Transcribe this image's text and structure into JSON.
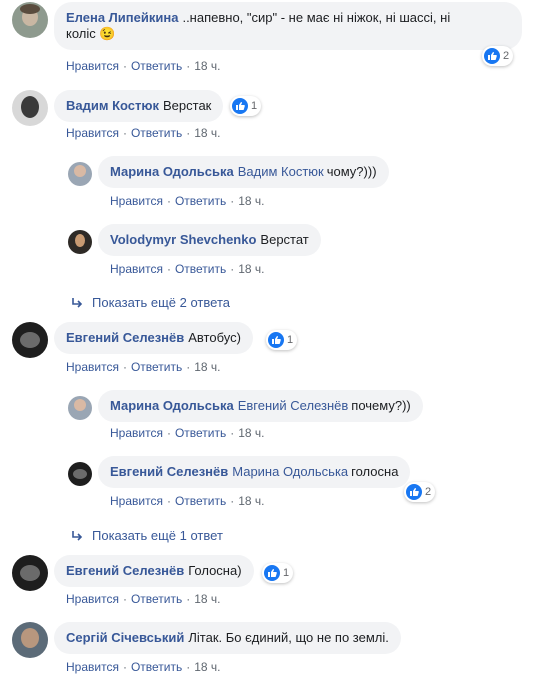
{
  "actions": {
    "like": "Нравится",
    "reply": "Ответить",
    "sep": "·"
  },
  "comments": [
    {
      "author": "Елена Липейкина",
      "text": "..напевно, \"сир\" - не має ні ніжок, ні шассі, ні",
      "text2": "коліс 😉",
      "likes": "2",
      "time": "18 ч."
    },
    {
      "author": "Вадим Костюк",
      "text": "Верстак",
      "likes": "1",
      "time": "18 ч."
    },
    {
      "author": "Марина Одольська",
      "mention": "Вадим Костюк",
      "text": "чому?)))",
      "time": "18 ч."
    },
    {
      "author": "Volodymyr Shevchenko",
      "text": "Верстат",
      "time": "18 ч."
    },
    {
      "author": "Евгений Селезнёв",
      "text": "Автобус)",
      "likes": "1",
      "time": "18 ч."
    },
    {
      "author": "Марина Одольська",
      "mention": "Евгений Селезнёв",
      "text": "почему?))",
      "time": "18 ч."
    },
    {
      "author": "Евгений Селезнёв",
      "mention": "Марина Одольська",
      "text": "голосна",
      "likes": "2",
      "time": "18 ч."
    },
    {
      "author": "Евгений Селезнёв",
      "text": "Голосна)",
      "likes": "1",
      "time": "18 ч."
    },
    {
      "author": "Сергій Січевський",
      "text": "Літак. Бо єдиний, що не по землі.",
      "time": "18 ч."
    }
  ],
  "more_replies": [
    {
      "label": "Показать ещё 2 ответа"
    },
    {
      "label": "Показать ещё 1 ответ"
    }
  ],
  "colors": {
    "link": "#385898",
    "bubble": "#f2f3f5",
    "like": "#1877f2",
    "meta": "#606770"
  }
}
